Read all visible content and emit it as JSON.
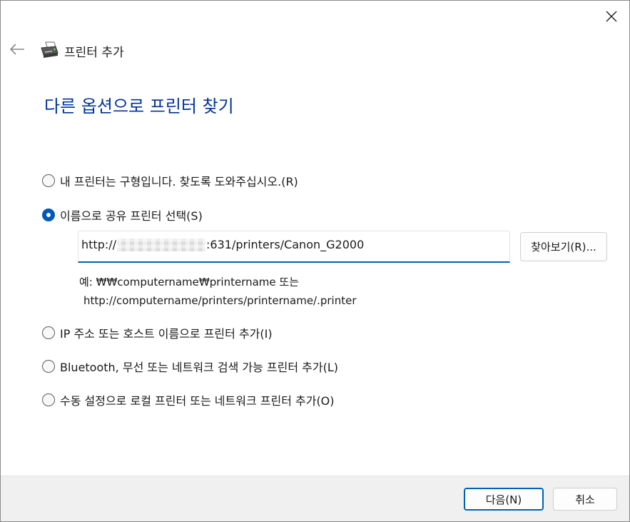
{
  "window": {
    "header_title": "프린터 추가",
    "heading": "다른 옵션으로 프린터 찾기"
  },
  "options": [
    {
      "label": "내 프린터는 구형입니다. 찾도록 도와주십시오.(R)",
      "checked": false
    },
    {
      "label": "이름으로 공유 프린터 선택(S)",
      "checked": true
    },
    {
      "label": "IP 주소 또는 호스트 이름으로 프린터 추가(I)",
      "checked": false
    },
    {
      "label": "Bluetooth, 무선 또는 네트워크 검색 가능 프린터 추가(L)",
      "checked": false
    },
    {
      "label": "수동 설정으로 로컬 프린터 또는 네트워크 프린터 추가(O)",
      "checked": false
    }
  ],
  "printer_path": {
    "prefix": "http://",
    "suffix": ":631/printers/Canon_G2000"
  },
  "browse_label": "찾아보기(R)...",
  "example": {
    "line1": "예: ₩₩computername₩printername 또는",
    "line2": "http://computername/printers/printername/.printer"
  },
  "footer": {
    "next_label": "다음(N)",
    "cancel_label": "취소"
  },
  "colors": {
    "accent": "#0063b1",
    "heading": "#003399"
  },
  "icons": {
    "close": "close-icon",
    "back": "back-arrow-icon",
    "printer": "printer-icon"
  }
}
